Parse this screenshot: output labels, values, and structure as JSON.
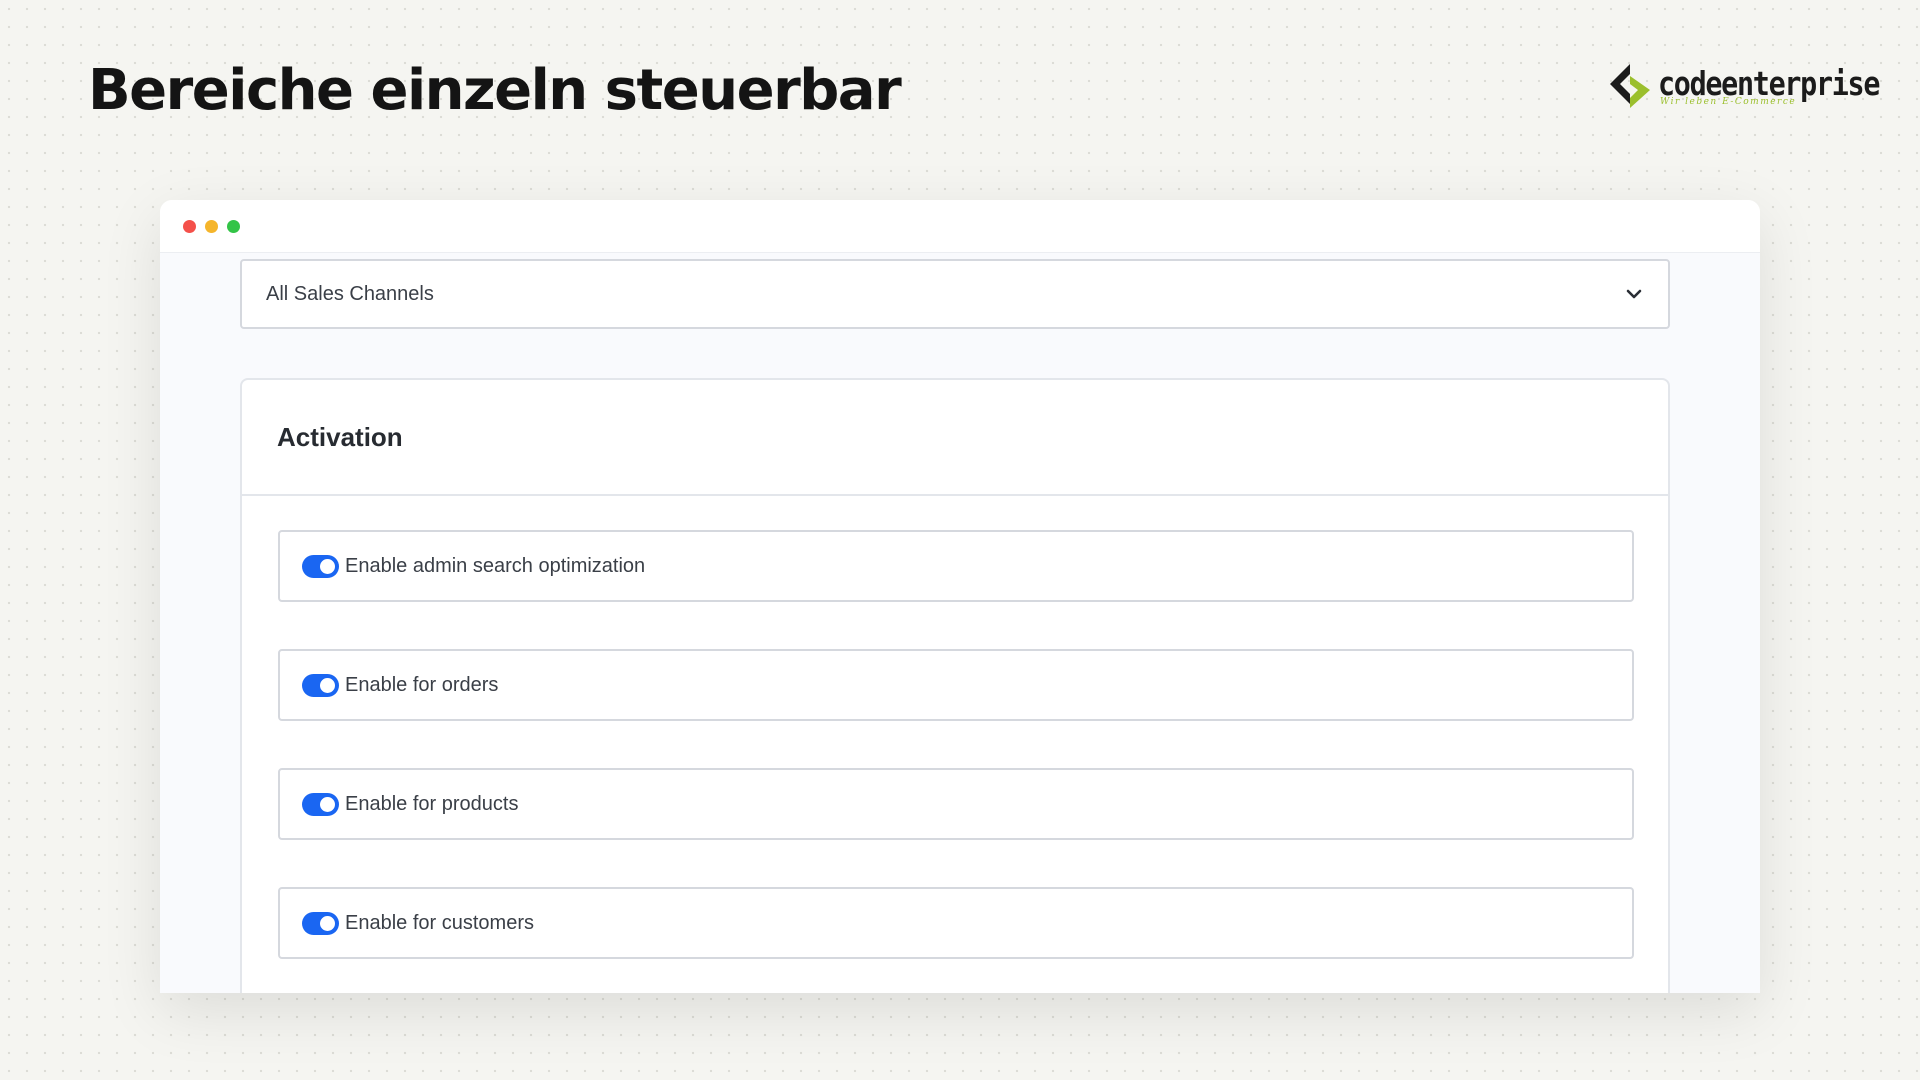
{
  "header": {
    "title": "Bereiche einzeln steuerbar"
  },
  "logo": {
    "name": "codeenterprise",
    "slogan": "Wir leben E-Commerce",
    "colors": {
      "dark": "#1b1b1b",
      "accent": "#9bbf2d"
    }
  },
  "window": {
    "controls": [
      "close",
      "minimize",
      "maximize"
    ],
    "sales_channel_select": {
      "value": "All Sales Channels",
      "icon": "chevron-down-icon"
    },
    "activation_card": {
      "title": "Activation",
      "options": [
        {
          "label": "Enable admin search optimization",
          "enabled": true
        },
        {
          "label": "Enable for orders",
          "enabled": true
        },
        {
          "label": "Enable for products",
          "enabled": true
        },
        {
          "label": "Enable for customers",
          "enabled": true
        }
      ]
    }
  },
  "colors": {
    "toggle_on": "#1a66f2",
    "background": "#f5f5f1"
  }
}
